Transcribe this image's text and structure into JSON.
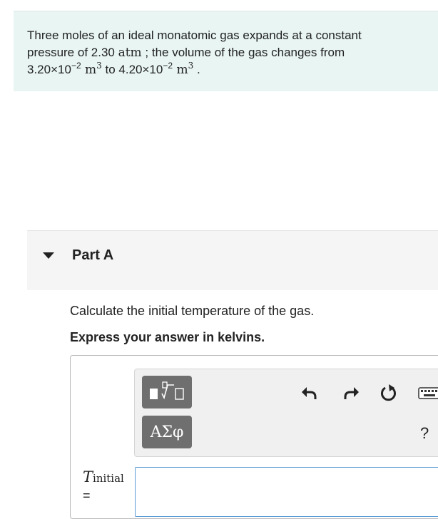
{
  "problem": {
    "line1": "Three moles of an ideal monatomic gas expands at a constant",
    "line2_pre": "pressure of 2.30 ",
    "line2_unit": "atm",
    "line2_post": " ; the volume of the gas changes from",
    "line3_v1": "3.20×10",
    "line3_v1_exp": "−2",
    "unit_m": " m",
    "unit_exp": "3",
    "line3_to": " to 4.20×10",
    "line3_v2_exp": "−2",
    "line3_end": " ."
  },
  "part": {
    "title": "Part A"
  },
  "question": "Calculate the initial temperature of the gas.",
  "instruction": "Express your answer in kelvins.",
  "toolbar": {
    "symbols_label": "ΑΣφ",
    "help_label": "?",
    "icons": [
      "templates-icon",
      "undo-icon",
      "redo-icon",
      "reset-icon",
      "keyboard-icon"
    ]
  },
  "answer": {
    "variable": "T",
    "subscript": "initial",
    "equals": "=",
    "value": ""
  }
}
